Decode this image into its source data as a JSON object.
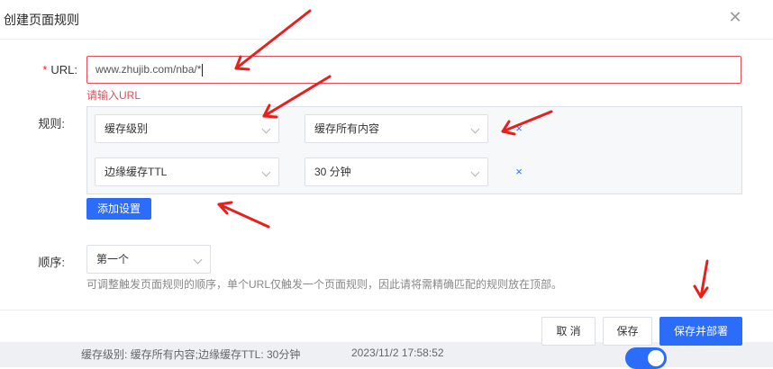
{
  "dialog": {
    "title": "创建页面规则",
    "close_icon": "close-icon"
  },
  "form": {
    "url": {
      "label": "URL:",
      "required_mark": "*",
      "value": "www.zhujib.com/nba/*",
      "error": "请输入URL"
    },
    "rules": {
      "label": "规则:",
      "rows": [
        {
          "setting": "缓存级别",
          "value": "缓存所有内容",
          "remove_icon": "×"
        },
        {
          "setting": "边缘缓存TTL",
          "value": "30 分钟",
          "remove_icon": "×"
        }
      ],
      "add_button": "添加设置"
    },
    "order": {
      "label": "顺序:",
      "value": "第一个",
      "hint": "可调整触发页面规则的顺序，单个URL仅触发一个页面规则，因此请将需精确匹配的规则放在顶部。"
    }
  },
  "footer": {
    "cancel": "取 消",
    "save": "保存",
    "save_deploy": "保存并部署"
  },
  "background": {
    "row_text": "缓存级别: 缓存所有内容;边缘缓存TTL: 30分钟",
    "row_time": "2023/11/2 17:58:52"
  },
  "annotations": {
    "arrow_color": "#e6201c",
    "arrow_count": 6
  }
}
